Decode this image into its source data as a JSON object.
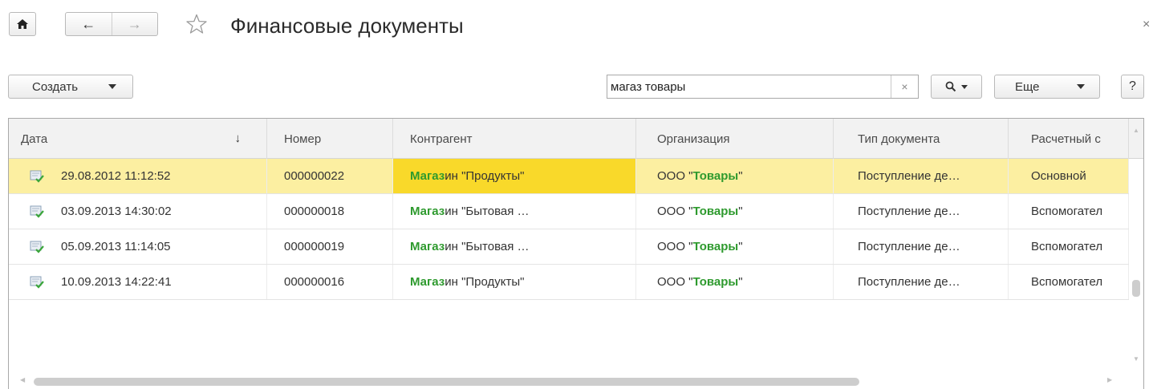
{
  "window": {
    "title": "Финансовые документы",
    "close_glyph": "×"
  },
  "nav": {
    "home_icon": "home-icon",
    "back_glyph": "←",
    "forward_glyph": "→",
    "favorite_icon": "star-outline-icon"
  },
  "toolbar": {
    "create_label": "Создать",
    "search_value": "магаз товары",
    "search_clear_glyph": "×",
    "more_label": "Еще",
    "help_label": "?"
  },
  "table": {
    "columns": [
      "Дата",
      "Номер",
      "Контрагент",
      "Организация",
      "Тип документа",
      "Расчетный с"
    ],
    "sort_indicator": "↓",
    "rows": [
      {
        "date": "29.08.2012 11:12:52",
        "number": "000000022",
        "counterparty_match": "Магаз",
        "counterparty_rest": "ин \"Продукты\"",
        "org_prefix": "ООО \"",
        "org_match": "Товары",
        "org_suffix": "\"",
        "doc_type": "Поступление де…",
        "account": "Основной",
        "selected": true
      },
      {
        "date": "03.09.2013 14:30:02",
        "number": "000000018",
        "counterparty_match": "Магаз",
        "counterparty_rest": "ин \"Бытовая …",
        "org_prefix": "ООО \"",
        "org_match": "Товары",
        "org_suffix": "\"",
        "doc_type": "Поступление де…",
        "account": "Вспомогател",
        "selected": false
      },
      {
        "date": "05.09.2013 11:14:05",
        "number": "000000019",
        "counterparty_match": "Магаз",
        "counterparty_rest": "ин \"Бытовая …",
        "org_prefix": "ООО \"",
        "org_match": "Товары",
        "org_suffix": "\"",
        "doc_type": "Поступление де…",
        "account": "Вспомогател",
        "selected": false
      },
      {
        "date": "10.09.2013 14:22:41",
        "number": "000000016",
        "counterparty_match": "Магаз",
        "counterparty_rest": "ин \"Продукты\"",
        "org_prefix": "ООО \"",
        "org_match": "Товары",
        "org_suffix": "\"",
        "doc_type": "Поступление де…",
        "account": "Вспомогател",
        "selected": false
      }
    ]
  },
  "colors": {
    "selected_row": "#fcefa1",
    "selected_cell": "#f9d92a",
    "match_highlight": "#2e9a2e"
  }
}
